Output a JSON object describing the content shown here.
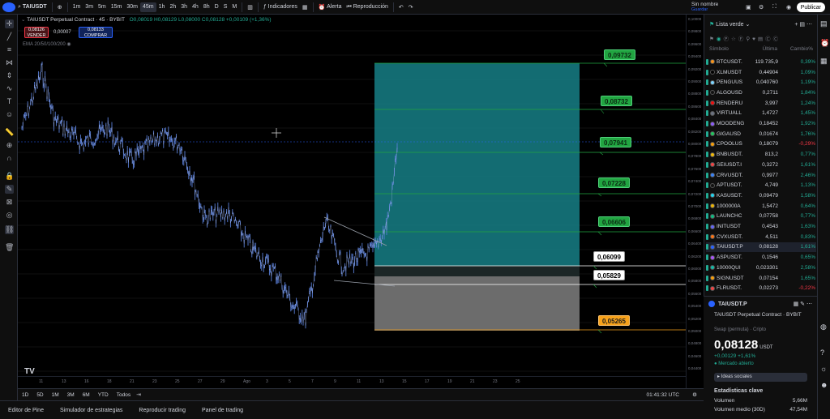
{
  "topbar": {
    "symbol": "TAIUSDT",
    "timeframes": [
      "1m",
      "3m",
      "5m",
      "15m",
      "30m",
      "45m",
      "1h",
      "2h",
      "3h",
      "4h",
      "8h",
      "D",
      "S",
      "M"
    ],
    "active_timeframe": "45m",
    "indicators_label": "Indicadores",
    "alert_label": "Alerta",
    "replay_label": "Reproducción",
    "layout_name": "Sin nombre",
    "layout_sub": "Guardar",
    "publish_label": "Publicar"
  },
  "legend": {
    "title": "TAIUSDT Perpetual Contract · 45 · BYBIT",
    "ohlc": "O0,08019 H0,08129 L0,08000 C0,08128 +0,00109 (+1,36%)",
    "sell_price": "0,08126",
    "sell_label": "VENDER",
    "spread": "0,00007",
    "buy_price": "0,08133",
    "buy_label": "COMPRAR",
    "ema": "EMA 20/50/100/200"
  },
  "targets": [
    {
      "label": "0,09732",
      "style": "green"
    },
    {
      "label": "0,08732",
      "style": "green"
    },
    {
      "label": "0,07941",
      "style": "green"
    },
    {
      "label": "0,07228",
      "style": "green"
    },
    {
      "label": "0,06606",
      "style": "green"
    },
    {
      "label": "0,06099",
      "style": "white"
    },
    {
      "label": "0,05829",
      "style": "white"
    },
    {
      "label": "0,05265",
      "style": "orange"
    }
  ],
  "price_scale": [
    "0,10000",
    "0,09800",
    "0,09600",
    "0,09400",
    "0,09200",
    "0,09000",
    "0,08800",
    "0,08600",
    "0,08400",
    "0,08200",
    "0,08000",
    "0,07800",
    "0,07600",
    "0,07400",
    "0,07200",
    "0,07000",
    "0,06800",
    "0,06600",
    "0,06400",
    "0,06200",
    "0,06000",
    "0,05800",
    "0,05600",
    "0,05400",
    "0,05200",
    "0,05000",
    "0,04800",
    "0,04600",
    "0,04400"
  ],
  "time_axis": [
    "11",
    "13",
    "16",
    "18",
    "21",
    "23",
    "25",
    "27",
    "29",
    "Ago",
    "3",
    "5",
    "7",
    "9",
    "11",
    "13",
    "15",
    "17",
    "19",
    "21",
    "23",
    "25"
  ],
  "bottom_strip": {
    "ranges": [
      "1D",
      "5D",
      "1M",
      "3M",
      "6M",
      "YTD",
      "Todos"
    ],
    "clock": "01:41:32 UTC"
  },
  "panelbar": [
    "Editor de Pine",
    "Simulador de estrategias",
    "Reproducir trading",
    "Panel de trading"
  ],
  "watchlist": {
    "title": "Lista verde",
    "col_symbol": "Símbolo",
    "col_last": "Última",
    "col_change": "Cambio%",
    "rows": [
      {
        "sym": "BTCUSDT.",
        "last": "119.735,9",
        "chg": "0,39%",
        "dir": "pos"
      },
      {
        "sym": "XLMUSDT",
        "last": "0,44904",
        "chg": "1,09%",
        "dir": "pos"
      },
      {
        "sym": "PENGUUS",
        "last": "0,040760",
        "chg": "1,19%",
        "dir": "pos"
      },
      {
        "sym": "ALGOUSD",
        "last": "0,2711",
        "chg": "1,84%",
        "dir": "pos"
      },
      {
        "sym": "RENDERU",
        "last": "3,997",
        "chg": "1,24%",
        "dir": "pos"
      },
      {
        "sym": "VIRTUALL",
        "last": "1,4727",
        "chg": "1,45%",
        "dir": "pos"
      },
      {
        "sym": "MOODENG",
        "last": "0,18452",
        "chg": "1,92%",
        "dir": "pos"
      },
      {
        "sym": "GIGAUSD",
        "last": "0,01674",
        "chg": "1,76%",
        "dir": "pos"
      },
      {
        "sym": "CPOOLUS",
        "last": "0,18079",
        "chg": "-0,29%",
        "dir": "neg"
      },
      {
        "sym": "BNBUSDT.",
        "last": "813,2",
        "chg": "0,77%",
        "dir": "pos"
      },
      {
        "sym": "SEIUSDT.I",
        "last": "0,3272",
        "chg": "1,61%",
        "dir": "pos"
      },
      {
        "sym": "CRVUSDT.",
        "last": "0,9977",
        "chg": "2,46%",
        "dir": "pos"
      },
      {
        "sym": "APTUSDT.",
        "last": "4,749",
        "chg": "1,13%",
        "dir": "pos"
      },
      {
        "sym": "KASUSDT.",
        "last": "0,09479",
        "chg": "1,58%",
        "dir": "pos"
      },
      {
        "sym": "1000000A",
        "last": "1,5472",
        "chg": "0,64%",
        "dir": "pos"
      },
      {
        "sym": "LAUNCHC",
        "last": "0,07758",
        "chg": "0,77%",
        "dir": "pos"
      },
      {
        "sym": "INITUSDT",
        "last": "0,4543",
        "chg": "1,63%",
        "dir": "pos"
      },
      {
        "sym": "CVXUSDT.",
        "last": "4,511",
        "chg": "0,83%",
        "dir": "pos"
      },
      {
        "sym": "TAIUSDT.P",
        "last": "0,08128",
        "chg": "1,61%",
        "dir": "pos"
      },
      {
        "sym": "ASPUSDT.",
        "last": "0,1546",
        "chg": "0,65%",
        "dir": "pos"
      },
      {
        "sym": "10000QUI",
        "last": "0,023301",
        "chg": "2,58%",
        "dir": "pos"
      },
      {
        "sym": "SIGNUSDT",
        "last": "0,07154",
        "chg": "1,65%",
        "dir": "pos"
      },
      {
        "sym": "FLRUSDT.",
        "last": "0,02273",
        "chg": "-0,22%",
        "dir": "neg"
      }
    ]
  },
  "detail": {
    "symbol": "TAIUSDT.P",
    "name": "TAIUSDT Perpetual Contract · BYBIT",
    "type": "Swap (permuta) · Cripto",
    "price": "0,08128",
    "currency": "USDT",
    "change": "+0,00129 +1,61%",
    "market_status": "Mercado abierto",
    "ideas_label": "Ideas sociales",
    "stats_title": "Estadísticas clave",
    "volume_label": "Volumen",
    "volume_value": "5,66M",
    "avg_volume_label": "Volumen medio (30D)",
    "avg_volume_value": "47,54M"
  },
  "colors": {
    "accent": "#2962ff",
    "up": "#22ab94",
    "down": "#f23645",
    "tp_zone": "#167f86",
    "sl_zone": "#787878"
  }
}
